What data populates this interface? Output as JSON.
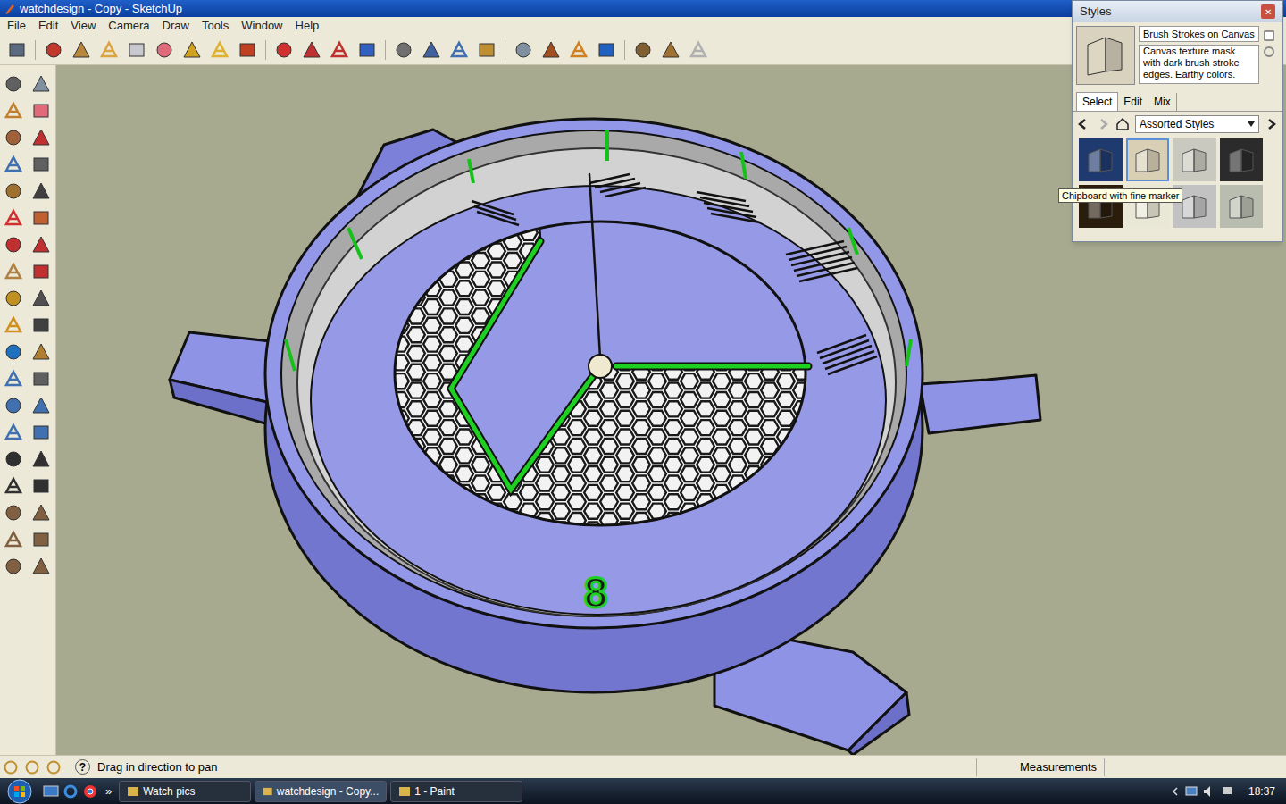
{
  "window": {
    "title": "watchdesign - Copy - SketchUp"
  },
  "menu": [
    "File",
    "Edit",
    "View",
    "Camera",
    "Draw",
    "Tools",
    "Window",
    "Help"
  ],
  "canvas": {
    "numeral": "8"
  },
  "status_bar": {
    "help_icon": "?",
    "message": "Drag in direction to pan",
    "measurements_label": "Measurements",
    "measurements_value": ""
  },
  "styles_panel": {
    "title": "Styles",
    "close": "✕",
    "style_name": "Brush Strokes on Canvas",
    "description": "Canvas texture mask with dark brush stroke edges.  Earthy colors.",
    "tabs": [
      {
        "label": "Select",
        "selected": true
      },
      {
        "label": "Edit",
        "selected": false
      },
      {
        "label": "Mix",
        "selected": false
      }
    ],
    "collection": "Assorted Styles",
    "thumbnails": [
      {
        "selected": false,
        "color": "#1f3a6e"
      },
      {
        "selected": true,
        "color": "#d9cfb5"
      },
      {
        "selected": false,
        "color": "#c9c9bf"
      },
      {
        "selected": false,
        "color": "#2b2b2b"
      },
      {
        "selected": false,
        "color": "#2a1d0c"
      },
      {
        "selected": false,
        "color": "#e9e8d6"
      },
      {
        "selected": false,
        "color": "#c2c2c2"
      },
      {
        "selected": false,
        "color": "#b9bdb0"
      }
    ],
    "tooltip": "Chipboard with fine marker"
  },
  "taskbar": {
    "chevron": "»",
    "items": [
      {
        "label": "Watch pics",
        "active": false
      },
      {
        "label": "watchdesign - Copy...",
        "active": true
      },
      {
        "label": "1 - Paint",
        "active": false
      }
    ],
    "clock": "18:37"
  }
}
